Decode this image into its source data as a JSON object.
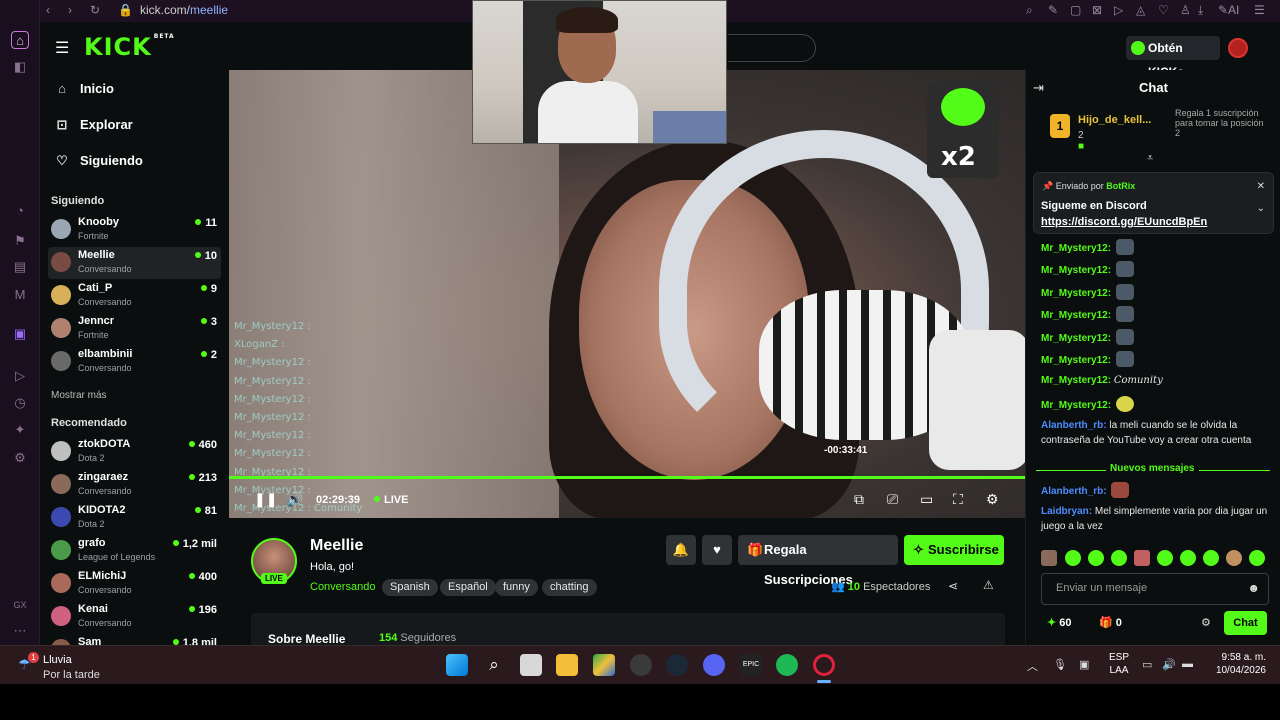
{
  "browser": {
    "url_domain": "kick.com/",
    "url_path": "meellie"
  },
  "header": {
    "logo": "KICK",
    "logo_beta": "BETA",
    "kicks_button": "Obtén KICKs"
  },
  "sidebar": {
    "nav": [
      {
        "label": "Inicio",
        "icon": "home-icon"
      },
      {
        "label": "Explorar",
        "icon": "compass-icon"
      },
      {
        "label": "Siguiendo",
        "icon": "heart-icon"
      }
    ],
    "following_title": "Siguiendo",
    "following": [
      {
        "name": "Knooby",
        "category": "Fortnite",
        "viewers": "11",
        "color": "#9aa7b3"
      },
      {
        "name": "Meellie",
        "category": "Conversando",
        "viewers": "10",
        "color": "#7a4a44"
      },
      {
        "name": "Cati_P",
        "category": "Conversando",
        "viewers": "9",
        "color": "#d8b05a"
      },
      {
        "name": "Jenncr",
        "category": "Fortnite",
        "viewers": "3",
        "color": "#b08070"
      },
      {
        "name": "elbambinii",
        "category": "Conversando",
        "viewers": "2",
        "color": "#6a6a6a"
      }
    ],
    "show_more": "Mostrar más",
    "recommended_title": "Recomendado",
    "recommended": [
      {
        "name": "ztokDOTA",
        "category": "Dota 2",
        "viewers": "460",
        "color": "#c0c0c0"
      },
      {
        "name": "zingaraez",
        "category": "Conversando",
        "viewers": "213",
        "color": "#8a6a5a"
      },
      {
        "name": "KIDOTA2",
        "category": "Dota 2",
        "viewers": "81",
        "color": "#3a4ab0"
      },
      {
        "name": "grafo",
        "category": "League of Legends",
        "viewers": "1,2 mil",
        "color": "#4a9a4a"
      },
      {
        "name": "ELMichiJ",
        "category": "Conversando",
        "viewers": "400",
        "color": "#aa6a5a"
      },
      {
        "name": "Kenai",
        "category": "Conversando",
        "viewers": "196",
        "color": "#d06080"
      },
      {
        "name": "Sam",
        "category": "",
        "viewers": "1,8 mil",
        "color": "#8a5a4a"
      }
    ]
  },
  "player": {
    "emote_multiplier": "x2",
    "overlay_chat": [
      "Mr_Mystery12 :",
      "XLoganZ :",
      "Mr_Mystery12 :",
      "Mr_Mystery12 :",
      "Mr_Mystery12 :",
      "Mr_Mystery12 :",
      "Mr_Mystery12 :",
      "Mr_Mystery12 :",
      "Mr_Mystery12 :",
      "Mr_Mystery12 :",
      "Mr_Mystery12 : Comunity",
      "Mr_Mystery12 :"
    ],
    "timeshift": "-00:33:41",
    "elapsed": "02:29:39",
    "live_label": "LIVE",
    "progress": 1.0
  },
  "stream": {
    "streamer": "Meellie",
    "live_badge": "LIVE",
    "title": "Hola, go!",
    "category": "Conversando",
    "tags": [
      "Spanish",
      "Español",
      "funny",
      "chatting"
    ],
    "gift_button": "Regala Suscripciones",
    "subscribe_button": "Suscribirse",
    "viewer_count": "10",
    "viewer_label": "Espectadores",
    "about_title": "Sobre Meellie",
    "followers_count": "154",
    "followers_label": "Seguidores"
  },
  "chat": {
    "title": "Chat",
    "leaderboard": {
      "rank": "1",
      "name": "Hijo_de_kell...",
      "count": "2"
    },
    "gift_slot": "Regala 1 suscripción para tomar la posición 2",
    "pinned": {
      "by_label": "Enviado por",
      "by_user": "BotRix",
      "text": "Sigueme en Discord",
      "link": "https://discord.gg/EUuncdBpEn"
    },
    "messages": [
      {
        "user": "Mr_Mystery12:",
        "text": "",
        "emote": "grey"
      },
      {
        "user": "Mr_Mystery12:",
        "text": "",
        "emote": "grey"
      },
      {
        "user": "Mr_Mystery12:",
        "text": "",
        "emote": "grey"
      },
      {
        "user": "Mr_Mystery12:",
        "text": "",
        "emote": "grey"
      },
      {
        "user": "Mr_Mystery12:",
        "text": "",
        "emote": "grey"
      },
      {
        "user": "Mr_Mystery12:",
        "text": "",
        "emote": "grey"
      },
      {
        "user": "Mr_Mystery12:",
        "text": "Comunity",
        "emote": ""
      },
      {
        "user": "Mr_Mystery12:",
        "text": "",
        "emote": "yellow"
      },
      {
        "user": "Alanberth_rb:",
        "text": "la meli cuando se le olvida la contraseña de YouTube voy a crear otra cuenta",
        "emote": "",
        "blue": true
      }
    ],
    "new_messages_label": "Nuevos mensajes",
    "messages_after": [
      {
        "user": "Alanberth_rb:",
        "text": "",
        "emote": "red",
        "blue": true
      },
      {
        "user": "Laidbryan:",
        "text": "Mel simplemente varia por dia jugar un juego a la vez",
        "emote": "",
        "blue": true
      }
    ],
    "input_placeholder": "Enviar un mensaje",
    "points": "60",
    "gifts": "0",
    "send_button": "Chat"
  },
  "taskbar": {
    "weather_badge": "1",
    "weather_line1": "Lluvia",
    "weather_line2": "Por la tarde",
    "lang_line1": "ESP",
    "lang_line2": "LAA",
    "time": "9:58 a. m.",
    "date": "10/04/2026"
  }
}
